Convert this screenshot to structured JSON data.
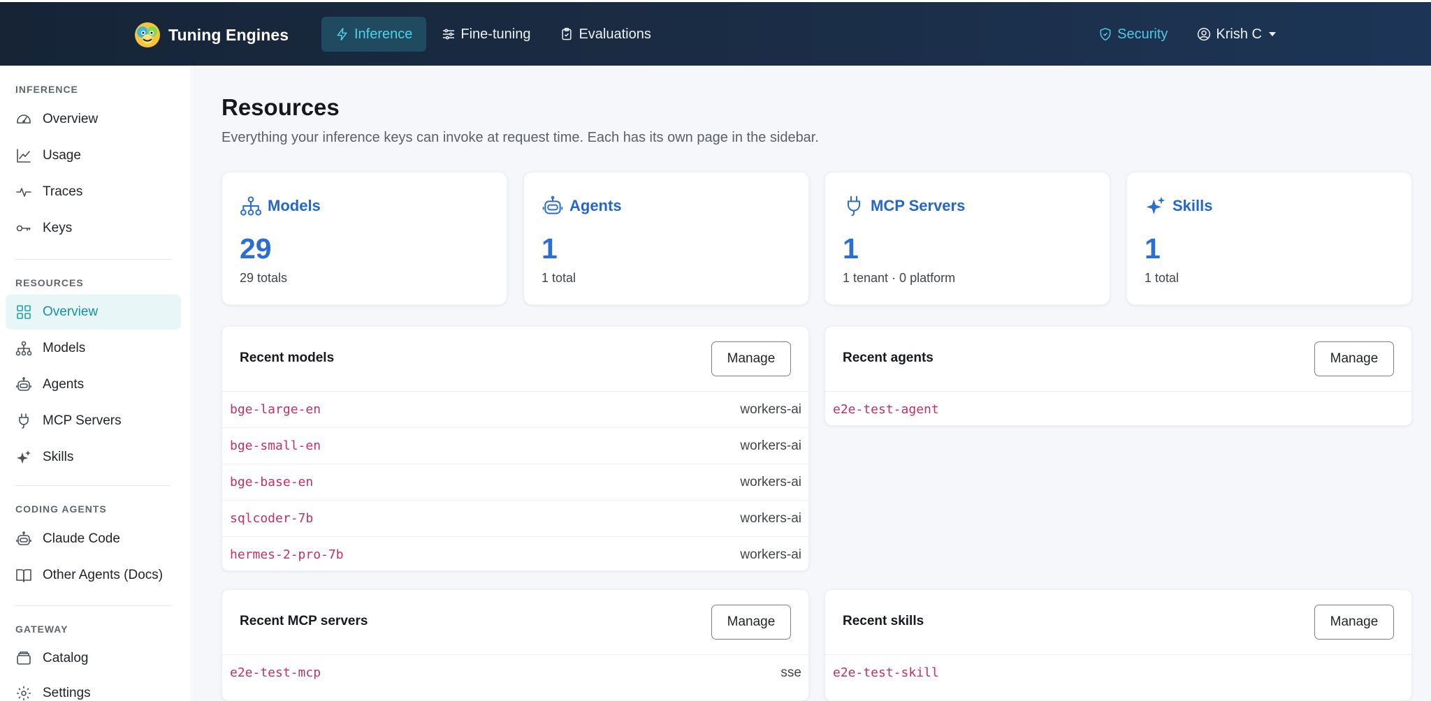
{
  "header": {
    "brand": "Tuning Engines",
    "nav": [
      {
        "label": "Inference",
        "icon": "lightning-icon",
        "active": true
      },
      {
        "label": "Fine-tuning",
        "icon": "sliders-icon",
        "active": false
      },
      {
        "label": "Evaluations",
        "icon": "clipboard-icon",
        "active": false
      }
    ],
    "security": "Security",
    "user": "Krish C"
  },
  "sidebar": {
    "sections": [
      {
        "title": "INFERENCE",
        "items": [
          {
            "label": "Overview",
            "icon": "gauge-icon"
          },
          {
            "label": "Usage",
            "icon": "line-chart-icon"
          },
          {
            "label": "Traces",
            "icon": "activity-icon"
          },
          {
            "label": "Keys",
            "icon": "key-icon"
          }
        ]
      },
      {
        "title": "RESOURCES",
        "items": [
          {
            "label": "Overview",
            "icon": "grid-icon",
            "active": true
          },
          {
            "label": "Models",
            "icon": "network-icon"
          },
          {
            "label": "Agents",
            "icon": "robot-icon"
          },
          {
            "label": "MCP Servers",
            "icon": "plug-icon"
          },
          {
            "label": "Skills",
            "icon": "sparkles-icon"
          }
        ]
      },
      {
        "title": "CODING AGENTS",
        "items": [
          {
            "label": "Claude Code",
            "icon": "robot-icon"
          },
          {
            "label": "Other Agents (Docs)",
            "icon": "book-icon"
          }
        ]
      },
      {
        "title": "GATEWAY",
        "items": [
          {
            "label": "Catalog",
            "icon": "folder-icon"
          },
          {
            "label": "Settings",
            "icon": "gear-icon"
          }
        ]
      }
    ]
  },
  "page": {
    "title": "Resources",
    "subtitle": "Everything your inference keys can invoke at request time. Each has its own page in the sidebar."
  },
  "stats": [
    {
      "title": "Models",
      "icon": "network-icon",
      "value": "29",
      "note": "29 totals"
    },
    {
      "title": "Agents",
      "icon": "robot-icon",
      "value": "1",
      "note": "1 total"
    },
    {
      "title": "MCP Servers",
      "icon": "plug-icon",
      "value": "1",
      "note": "1 tenant · 0 platform"
    },
    {
      "title": "Skills",
      "icon": "sparkles-icon",
      "value": "1",
      "note": "1 total"
    }
  ],
  "panels": {
    "recent_models": {
      "title": "Recent models",
      "button": "Manage",
      "rows": [
        {
          "name": "bge-large-en",
          "provider": "workers-ai"
        },
        {
          "name": "bge-small-en",
          "provider": "workers-ai"
        },
        {
          "name": "bge-base-en",
          "provider": "workers-ai"
        },
        {
          "name": "sqlcoder-7b",
          "provider": "workers-ai"
        },
        {
          "name": "hermes-2-pro-7b",
          "provider": "workers-ai"
        }
      ]
    },
    "recent_agents": {
      "title": "Recent agents",
      "button": "Manage",
      "rows": [
        {
          "name": "e2e-test-agent",
          "provider": ""
        }
      ]
    },
    "recent_mcp": {
      "title": "Recent MCP servers",
      "button": "Manage",
      "rows": [
        {
          "name": "e2e-test-mcp",
          "provider": "sse"
        }
      ]
    },
    "recent_skills": {
      "title": "Recent skills",
      "button": "Manage",
      "rows": [
        {
          "name": "e2e-test-skill",
          "provider": ""
        }
      ]
    }
  },
  "colors": {
    "accent": "#2b6fd2",
    "active_teal": "#1591a4",
    "header_bg": "#162436",
    "code": "#c0306a"
  }
}
